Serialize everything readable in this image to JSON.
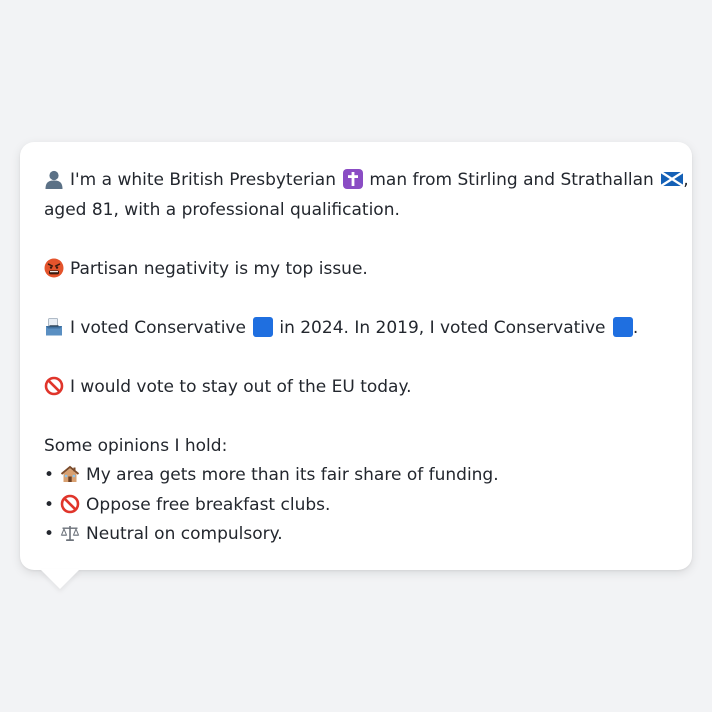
{
  "bio": {
    "line1_part1": "I'm a white British Presbyterian",
    "line1_part2": "man from Stirling and Strathallan",
    "line1_comma": ",",
    "line2": "aged 81, with a professional qualification."
  },
  "issue": {
    "text": "Partisan negativity is my top issue."
  },
  "vote": {
    "part1": "I voted Conservative",
    "part2": "in 2024. In 2019, I voted Conservative",
    "part3": "."
  },
  "eu": {
    "text": "I would vote to stay out of the EU today."
  },
  "opinions": {
    "heading": "Some opinions I hold:",
    "bullet": "•",
    "items": [
      {
        "icon": "house-icon",
        "text": "My area gets more than its fair share of funding."
      },
      {
        "icon": "prohibited-icon",
        "text": "Oppose free breakfast clubs."
      },
      {
        "icon": "scales-icon",
        "text": "Neutral on compulsory."
      }
    ]
  },
  "colors": {
    "background": "#f2f3f5",
    "card": "#ffffff",
    "text": "#23272e",
    "conservative_blue": "#1f6fe0"
  }
}
